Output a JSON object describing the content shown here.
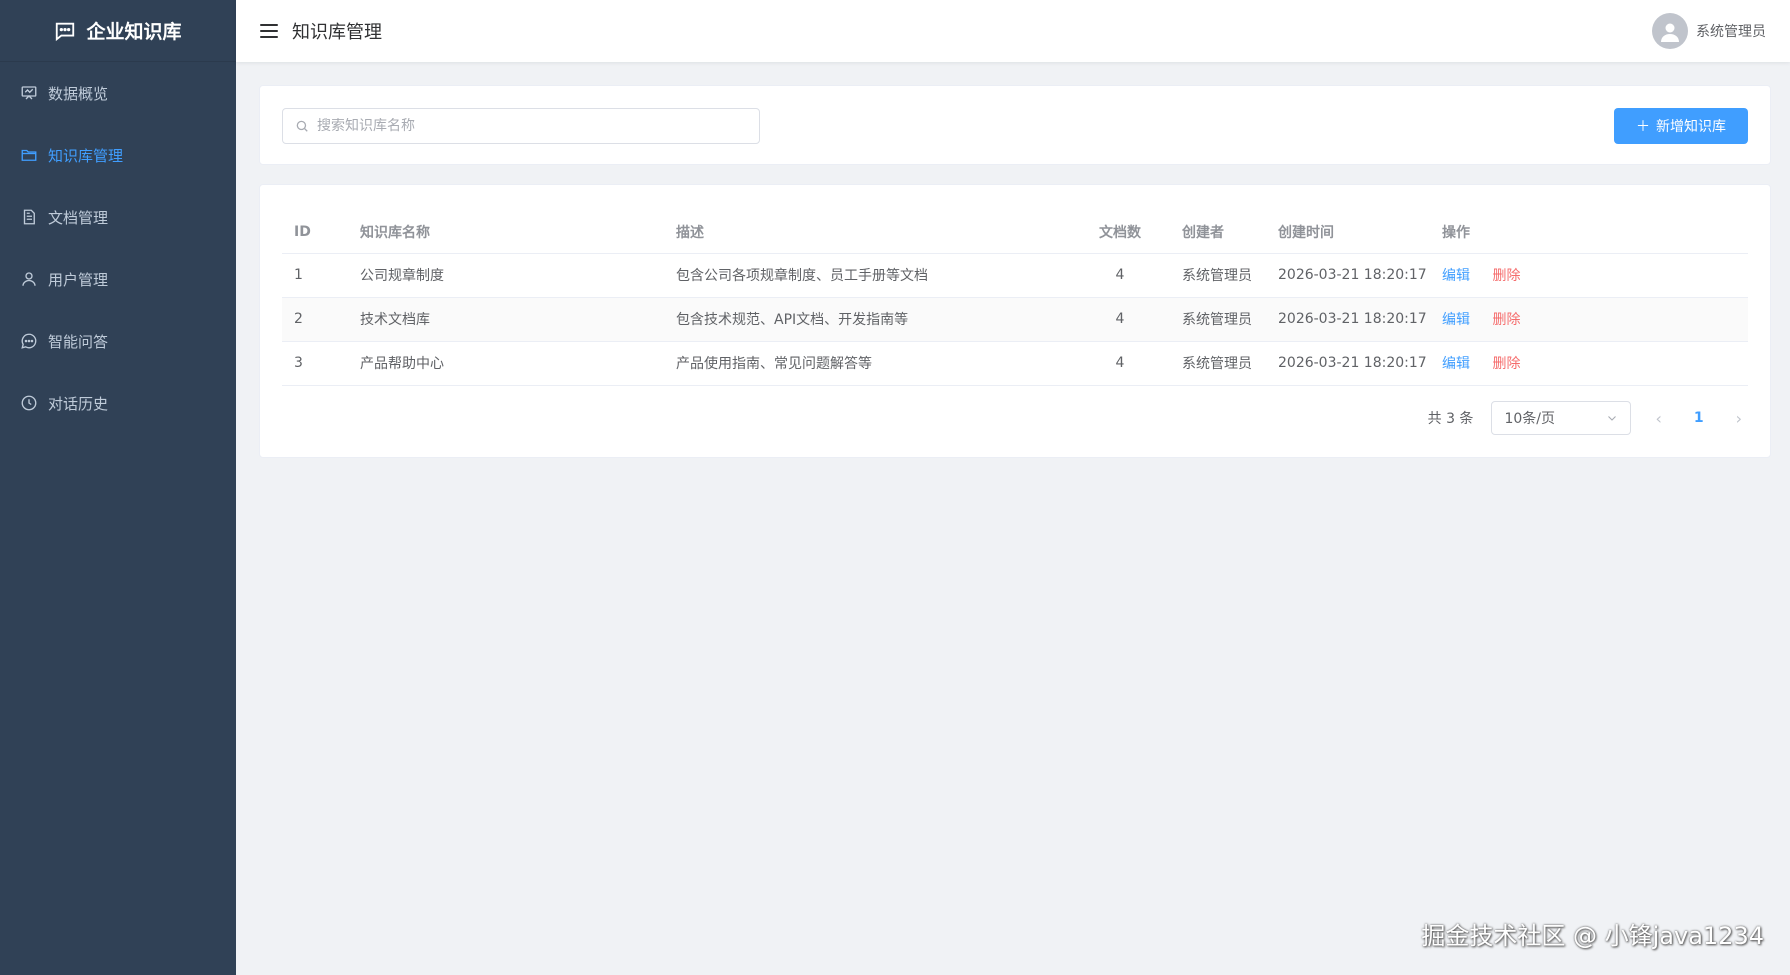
{
  "brand": {
    "title": "企业知识库",
    "icon": "chat-icon"
  },
  "sidebar": {
    "items": [
      {
        "label": "数据概览",
        "icon": "dashboard-icon",
        "active": false
      },
      {
        "label": "知识库管理",
        "icon": "folder-icon",
        "active": true
      },
      {
        "label": "文档管理",
        "icon": "document-icon",
        "active": false
      },
      {
        "label": "用户管理",
        "icon": "user-icon",
        "active": false
      },
      {
        "label": "智能问答",
        "icon": "chat-bubble-icon",
        "active": false
      },
      {
        "label": "对话历史",
        "icon": "clock-icon",
        "active": false
      }
    ]
  },
  "header": {
    "title": "知识库管理",
    "user_name": "系统管理员"
  },
  "search": {
    "placeholder": "搜索知识库名称",
    "value": ""
  },
  "toolbar": {
    "add_label": "新增知识库"
  },
  "table": {
    "columns": [
      "ID",
      "知识库名称",
      "描述",
      "文档数",
      "创建者",
      "创建时间",
      "操作"
    ],
    "rows": [
      {
        "id": "1",
        "name": "公司规章制度",
        "desc": "包含公司各项规章制度、员工手册等文档",
        "docs": "4",
        "creator": "系统管理员",
        "created": "2026-03-21 18:20:17"
      },
      {
        "id": "2",
        "name": "技术文档库",
        "desc": "包含技术规范、API文档、开发指南等",
        "docs": "4",
        "creator": "系统管理员",
        "created": "2026-03-21 18:20:17"
      },
      {
        "id": "3",
        "name": "产品帮助中心",
        "desc": "产品使用指南、常见问题解答等",
        "docs": "4",
        "creator": "系统管理员",
        "created": "2026-03-21 18:20:17"
      }
    ],
    "actions": {
      "edit": "编辑",
      "delete": "删除"
    }
  },
  "pagination": {
    "total_text": "共 3 条",
    "page_size": "10条/页",
    "current_page": "1"
  },
  "watermark": "掘金技术社区 @ 小锋java1234",
  "colors": {
    "sidebar_bg": "#304156",
    "accent": "#409eff",
    "danger": "#f56c6c"
  }
}
